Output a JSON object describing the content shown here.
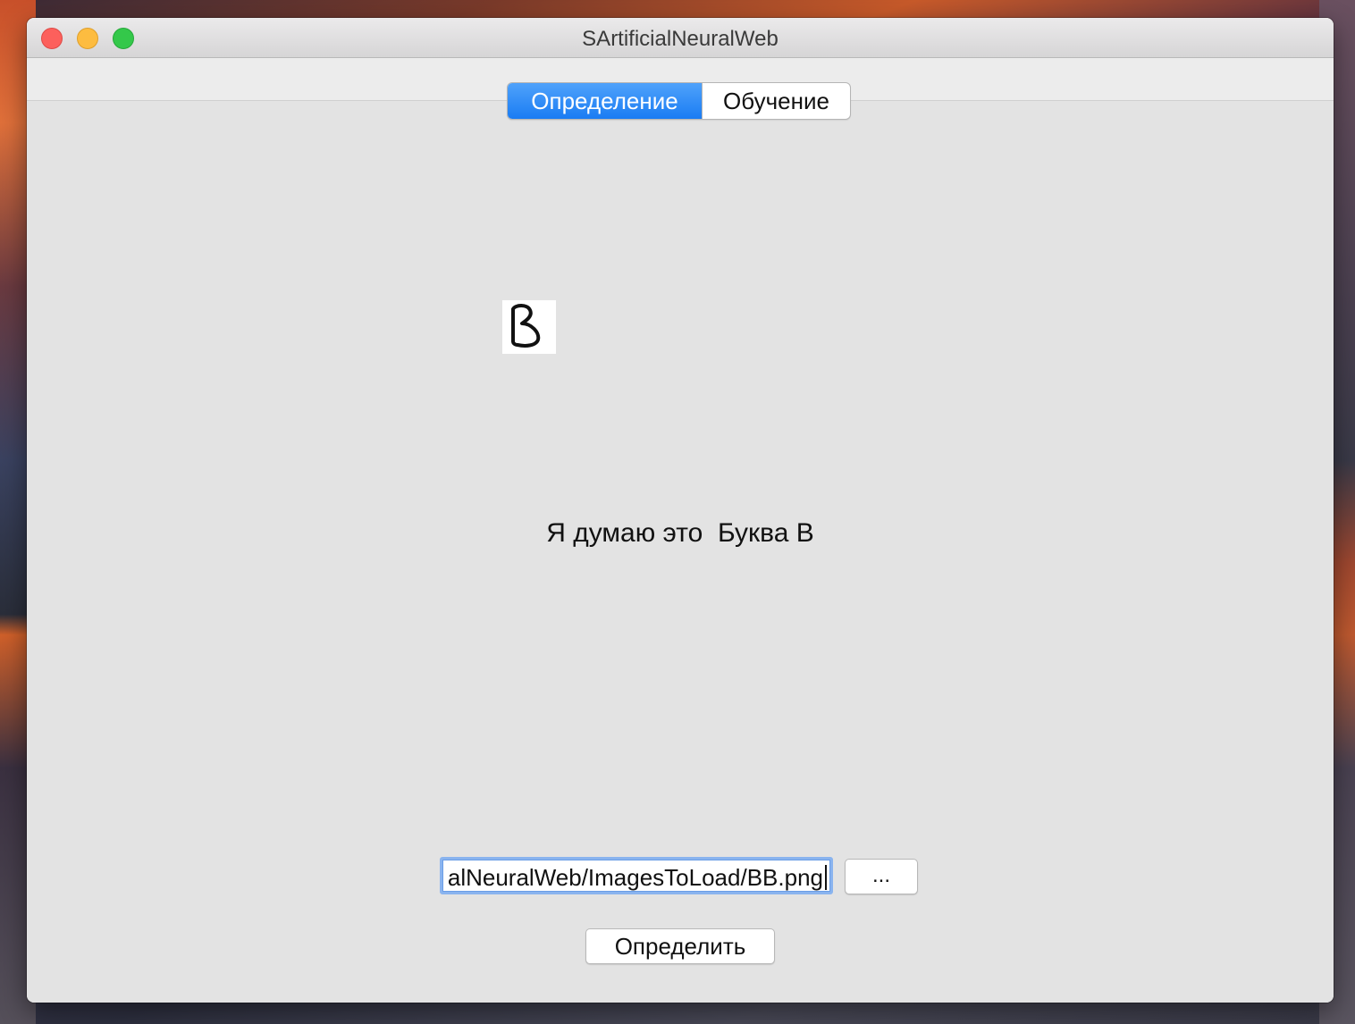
{
  "window": {
    "title": "SArtificialNeuralWeb"
  },
  "tabs": [
    {
      "label": "Определение",
      "active": true
    },
    {
      "label": "Обучение",
      "active": false
    }
  ],
  "preview": {
    "glyph": "B"
  },
  "result": {
    "prefix": "Я думаю это",
    "answer": "Буква В"
  },
  "path_input": {
    "value": "alNeuralWeb/ImagesToLoad/BB.png"
  },
  "buttons": {
    "browse_label": "...",
    "detect_label": "Определить"
  },
  "colors": {
    "accent": "#1a7cf3",
    "close": "#fc605c",
    "minimize": "#fdbc40",
    "maximize": "#34c84a"
  }
}
